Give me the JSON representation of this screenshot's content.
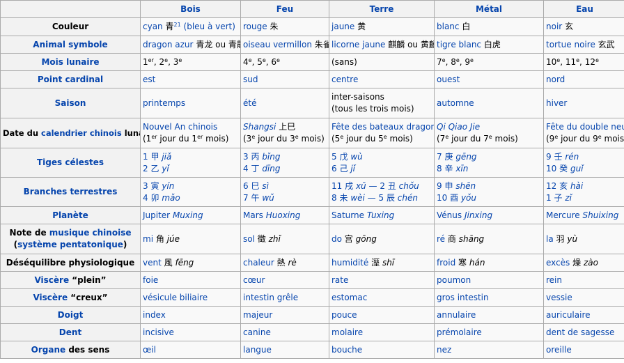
{
  "headers": [
    "",
    "Bois",
    "Feu",
    "Terre",
    "Métal",
    "Eau"
  ],
  "rows": {
    "couleur": {
      "label": "Couleur",
      "bois": {
        "text": "cyan",
        "han": "青",
        "ref": "21",
        "extra": "(bleu à vert)"
      },
      "feu": {
        "text": "rouge",
        "han": "朱"
      },
      "terre": {
        "text": "jaune",
        "han": "黄"
      },
      "metal": {
        "text": "blanc",
        "han": "白"
      },
      "eau": {
        "text": "noir",
        "han": "玄"
      }
    },
    "animal": {
      "label": "Animal symbole",
      "bois": {
        "text": "dragon azur",
        "han": "青龙 ou 青龍"
      },
      "feu": {
        "text": "oiseau vermillon",
        "han": "朱雀"
      },
      "terre": {
        "text": "licorne jaune",
        "han": "麒麟 ou 黄麟"
      },
      "metal": {
        "text": "tigre blanc",
        "han": "白虎"
      },
      "eau": {
        "text": "tortue noire",
        "han": "玄武"
      }
    },
    "mois": {
      "label": "Mois lunaire",
      "bois": {
        "a": "1",
        "b": "2",
        "c": "3",
        "sup": "er",
        "sup2": "e",
        "sep": ", "
      },
      "feu": {
        "a": "4",
        "b": "5",
        "c": "6",
        "sup": "e"
      },
      "terre": "(sans)",
      "metal": {
        "a": "7",
        "b": "8",
        "c": "9",
        "sup": "e"
      },
      "eau": {
        "a": "10",
        "b": "11",
        "c": "12",
        "sup": "e"
      }
    },
    "point": {
      "label": "Point cardinal",
      "bois": "est",
      "feu": "sud",
      "terre": "centre",
      "metal": "ouest",
      "eau": "nord"
    },
    "saison": {
      "label": "Saison",
      "bois": "printemps",
      "feu": "été",
      "terre": {
        "l1": "inter-saisons",
        "l2": "(tous les trois mois)"
      },
      "metal": "automne",
      "eau": "hiver"
    },
    "date": {
      "label_pre": "Date du ",
      "label_link": "calendrier chinois",
      "label_post": " lunaire",
      "bois": {
        "l1": "Nouvel An chinois",
        "a": "(1",
        "s1": "er",
        "b": " jour du 1",
        "s2": "er",
        "c": " mois)"
      },
      "feu": {
        "name": "Shangsi",
        "han": "上巳",
        "a": "(3",
        "s1": "e",
        "b": " jour du 3",
        "s2": "e",
        "c": " mois)"
      },
      "terre": {
        "l1": "Fête des bateaux dragons",
        "a": "(5",
        "s1": "e",
        "b": " jour du 5",
        "s2": "e",
        "c": " mois)"
      },
      "metal": {
        "name": "Qi Qiao Jie",
        "a": "(7",
        "s1": "e",
        "b": " jour du 7",
        "s2": "e",
        "c": " mois)"
      },
      "eau": {
        "l1": "Fête du double neuf",
        "a": "(9",
        "s1": "e",
        "b": " jour du 9",
        "s2": "e",
        "c": " mois)"
      }
    },
    "tiges": {
      "label": "Tiges célestes",
      "bois": [
        {
          "n": "1",
          "han": "甲",
          "py": "jiǎ"
        },
        {
          "n": "2",
          "han": "乙",
          "py": "yǐ"
        }
      ],
      "feu": [
        {
          "n": "3",
          "han": "丙",
          "py": "bǐng"
        },
        {
          "n": "4",
          "han": "丁",
          "py": "dīng"
        }
      ],
      "terre": [
        {
          "n": "5",
          "han": "戊",
          "py": "wù"
        },
        {
          "n": "6",
          "han": "己",
          "py": "jǐ"
        }
      ],
      "metal": [
        {
          "n": "7",
          "han": "庚",
          "py": "gēng"
        },
        {
          "n": "8",
          "han": "辛",
          "py": "xīn"
        }
      ],
      "eau": [
        {
          "n": "9",
          "han": "壬",
          "py": "rén"
        },
        {
          "n": "10",
          "han": "癸",
          "py": "guǐ"
        }
      ]
    },
    "branches": {
      "label": "Branches terrestres",
      "bois": [
        {
          "n": "3",
          "han": "寅",
          "py": "yín"
        },
        {
          "n": "4",
          "han": "卯",
          "py": "mǎo"
        }
      ],
      "feu": [
        {
          "n": "6",
          "han": "巳",
          "py": "sì"
        },
        {
          "n": "7",
          "han": "午",
          "py": "wǔ"
        }
      ],
      "terre": [
        {
          "n": "11",
          "han": "戌",
          "py": "xū",
          "n2": "2",
          "han2": "丑",
          "py2": "chǒu"
        },
        {
          "n": "8",
          "han": "未",
          "py": "wèi",
          "n2": "5",
          "han2": "辰",
          "py2": "chén"
        }
      ],
      "metal": [
        {
          "n": "9",
          "han": "申",
          "py": "shēn"
        },
        {
          "n": "10",
          "han": "酉",
          "py": "yǒu"
        }
      ],
      "eau": [
        {
          "n": "12",
          "han": "亥",
          "py": "hài"
        },
        {
          "n": "1",
          "han": "子",
          "py": "zǐ"
        }
      ]
    },
    "planete": {
      "label": "Planète",
      "bois": {
        "fr": "Jupiter",
        "cn": "Muxing"
      },
      "feu": {
        "fr": "Mars",
        "cn": "Huoxing"
      },
      "terre": {
        "fr": "Saturne",
        "cn": "Tuxing"
      },
      "metal": {
        "fr": "Vénus",
        "cn": "Jinxing"
      },
      "eau": {
        "fr": "Mercure",
        "cn": "Shuixing"
      }
    },
    "note": {
      "label_pre": "Note de ",
      "label_link": "musique chinoise",
      "label_l2_open": "(",
      "label_link2": "système pentatonique",
      "label_l2_close": ")",
      "bois": {
        "fr": "mi",
        "han": "角",
        "py": "júe"
      },
      "feu": {
        "fr": "sol",
        "han": "徵",
        "py": "zhǐ"
      },
      "terre": {
        "fr": "do",
        "han": "宫",
        "py": "gōng"
      },
      "metal": {
        "fr": "ré",
        "han": "商",
        "py": "shāng"
      },
      "eau": {
        "fr": "la",
        "han": "羽",
        "py": "yù"
      }
    },
    "desequilibre": {
      "label": "Déséquilibre physiologique",
      "bois": {
        "fr": "vent",
        "han": "風",
        "py": "fēng"
      },
      "feu": {
        "fr": "chaleur",
        "han": "熱",
        "py": "rè"
      },
      "terre": {
        "fr": "humidité",
        "han": "溼",
        "py": "shī"
      },
      "metal": {
        "fr": "froid",
        "han": "寒",
        "py": "hán"
      },
      "eau": {
        "fr": "excès",
        "han": "燥",
        "py": "zào"
      }
    },
    "viscere_plein": {
      "label_link": "Viscère",
      "label_post": " “plein”",
      "bois": "foie",
      "feu": "cœur",
      "terre": "rate",
      "metal": "poumon",
      "eau": "rein"
    },
    "viscere_creux": {
      "label_link": "Viscère",
      "label_post": " “creux”",
      "bois": "vésicule biliaire",
      "feu": "intestin grêle",
      "terre": "estomac",
      "metal": "gros intestin",
      "eau": "vessie"
    },
    "doigt": {
      "label": "Doigt",
      "bois": "index",
      "feu": "majeur",
      "terre": "pouce",
      "metal": "annulaire",
      "eau": "auriculaire"
    },
    "dent": {
      "label": "Dent",
      "bois": "incisive",
      "feu": "canine",
      "terre": "molaire",
      "metal": "prémolaire",
      "eau": "dent de sagesse"
    },
    "organe": {
      "label_link": "Organe",
      "label_post": " des sens",
      "bois": "œil",
      "feu": "langue",
      "terre": "bouche",
      "metal": "nez",
      "eau": "oreille"
    }
  }
}
